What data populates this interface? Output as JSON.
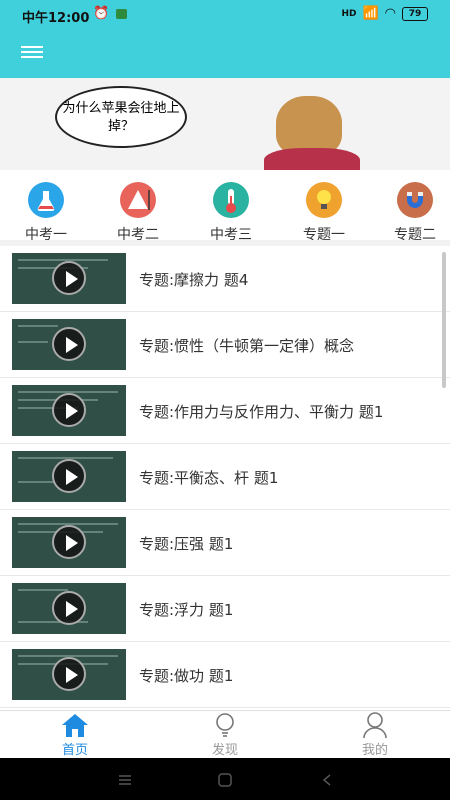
{
  "status_bar": {
    "time": "中午12:00",
    "network": "HD",
    "battery": "79"
  },
  "banner": {
    "bubble_text": "为什么苹果会往地上掉？"
  },
  "categories": [
    {
      "label": "中考一",
      "icon": "flask-icon",
      "color": "#2aa6e8"
    },
    {
      "label": "中考二",
      "icon": "triangle-icon",
      "color": "#e8645a"
    },
    {
      "label": "中考三",
      "icon": "thermometer-icon",
      "color": "#2ab3a0"
    },
    {
      "label": "专题一",
      "icon": "lightbulb-icon",
      "color": "#f0a22e"
    },
    {
      "label": "专题二",
      "icon": "magnet-icon",
      "color": "#c96e4b"
    }
  ],
  "videos": [
    {
      "title": "专题:摩擦力 题4"
    },
    {
      "title": "专题:惯性（牛顿第一定律）概念"
    },
    {
      "title": "专题:作用力与反作用力、平衡力 题1"
    },
    {
      "title": "专题:平衡态、杆 题1"
    },
    {
      "title": "专题:压强 题1"
    },
    {
      "title": "专题:浮力 题1"
    },
    {
      "title": "专题:做功 题1"
    },
    {
      "title": ""
    }
  ],
  "tabs": [
    {
      "label": "首页",
      "icon": "home-icon"
    },
    {
      "label": "发现",
      "icon": "lightbulb-icon"
    },
    {
      "label": "我的",
      "icon": "person-icon"
    }
  ],
  "colors": {
    "accent": "#3fd0dc",
    "active_tab": "#1f8be0"
  }
}
